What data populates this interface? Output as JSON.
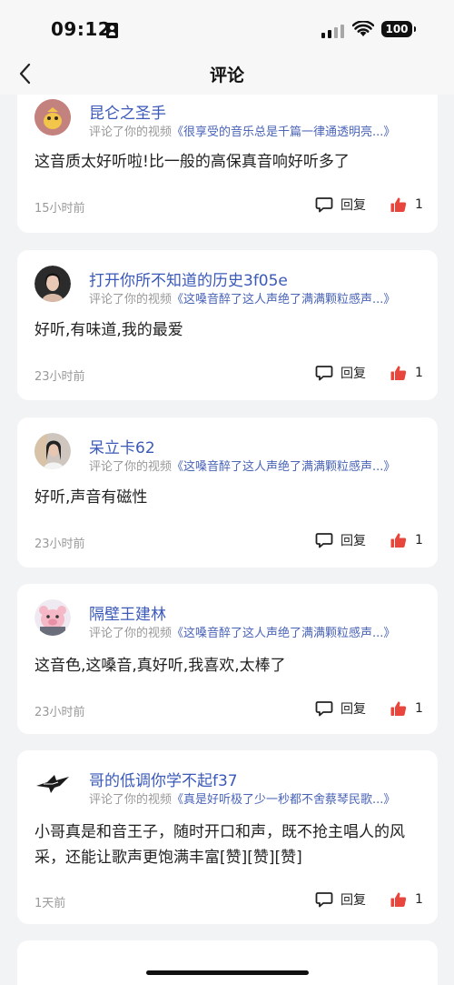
{
  "status_bar": {
    "time": "09:12",
    "battery": "100"
  },
  "header": {
    "title": "评论"
  },
  "comments": [
    {
      "username": "昆仑之圣手",
      "action": "评论了你的视频",
      "video_title": "《很享受的音乐总是千篇一律通透明亮...》",
      "text": "这音质太好听啦!比一般的高保真音响好听多了",
      "time": "15小时前",
      "reply_label": "回复",
      "likes": "1"
    },
    {
      "username": "打开你所不知道的历史3f05e",
      "action": "评论了你的视频",
      "video_title": "《这嗓音醉了这人声绝了满满颗粒感声...》",
      "text": "好听,有味道,我的最爱",
      "time": "23小时前",
      "reply_label": "回复",
      "likes": "1"
    },
    {
      "username": "呆立卡62",
      "action": "评论了你的视频",
      "video_title": "《这嗓音醉了这人声绝了满满颗粒感声...》",
      "text": "好听,声音有磁性",
      "time": "23小时前",
      "reply_label": "回复",
      "likes": "1"
    },
    {
      "username": "隔壁王建林",
      "action": "评论了你的视频",
      "video_title": "《这嗓音醉了这人声绝了满满颗粒感声...》",
      "text": "这音色,这嗓音,真好听,我喜欢,太棒了",
      "time": "23小时前",
      "reply_label": "回复",
      "likes": "1"
    },
    {
      "username": "哥的低调你学不起f37",
      "action": "评论了你的视频",
      "video_title": "《真是好听极了少一秒都不舍蔡琴民歌...》",
      "text": "小哥真是和音王子，随时开口和声，既不抢主唱人的风采，还能让歌声更饱满丰富[赞][赞][赞]",
      "time": "1天前",
      "reply_label": "回复",
      "likes": "1"
    }
  ],
  "colors": {
    "accent": "#3a59b8",
    "like": "#e8453c",
    "background": "#f2f3f5"
  }
}
